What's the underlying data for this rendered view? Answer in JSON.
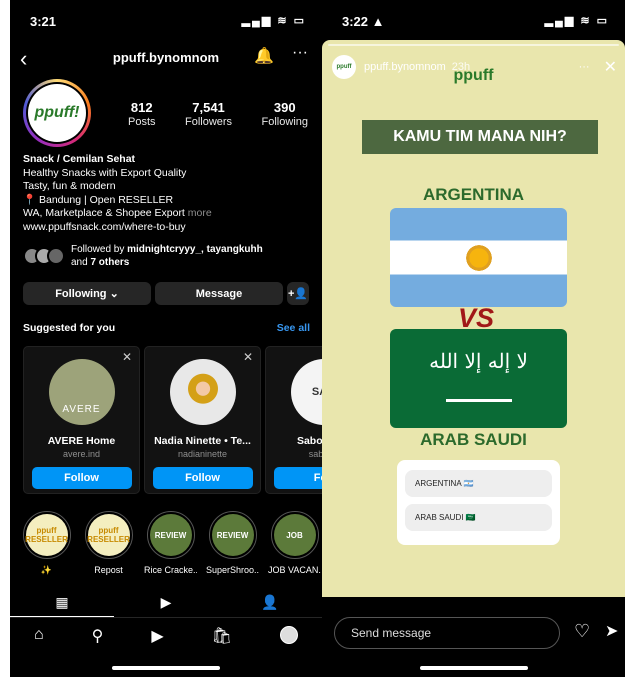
{
  "left": {
    "status": {
      "time": "3:21",
      "icons": "▂▄▆ ≋ ▭"
    },
    "header": {
      "username": "ppuff.bynomnom"
    },
    "avatar_text": "ppuff!",
    "stats": [
      {
        "num": "812",
        "label": "Posts"
      },
      {
        "num": "7,541",
        "label": "Followers"
      },
      {
        "num": "390",
        "label": "Following"
      }
    ],
    "bio": {
      "name": "Snack / Cemilan Sehat",
      "lines": [
        "Healthy Snacks with Export Quality",
        "Tasty, fun & modern",
        "📍 Bandung | Open RESELLER"
      ],
      "last_line": "WA, Marketplace & Shopee Export",
      "more": "more",
      "link": "www.ppuffsnack.com/where-to-buy"
    },
    "followed": {
      "prefix": "Followed by ",
      "names": "midnightcryyy_, tayangkuhh",
      "and": "and ",
      "others": "7 others"
    },
    "actions": {
      "following": "Following ⌄",
      "message": "Message",
      "add": "+👤"
    },
    "suggested": {
      "title": "Suggested for you",
      "see_all": "See all"
    },
    "cards": [
      {
        "name": "AVERE Home",
        "user": "avere.ind",
        "pic": "AVERE",
        "follow": "Follow"
      },
      {
        "name": "Nadia Ninette • Te...",
        "user": "nadianinette",
        "pic": "",
        "follow": "Follow"
      },
      {
        "name": "Saboën by",
        "user": "saboen",
        "pic": "SAB",
        "follow": "Foll"
      }
    ],
    "highlights": [
      {
        "label": "✨",
        "badge": "ppuff RESELLER"
      },
      {
        "label": "Repost",
        "badge": "ppuff RESELLER"
      },
      {
        "label": "Rice Cracke...",
        "badge": "REVIEW"
      },
      {
        "label": "SuperShroo...",
        "badge": "REVIEW"
      },
      {
        "label": "JOB VACAN...",
        "badge": "JOB"
      }
    ]
  },
  "right": {
    "status": {
      "time": "3:22 ▲",
      "icons": "▂▄▆ ≋ ▭"
    },
    "story": {
      "user": "ppuff.bynomnom",
      "age": "23h",
      "avatar": "ppuff",
      "brand": "ppuff",
      "question": "KAMU TIM MANA NIH?",
      "team1": "ARGENTINA",
      "vs": "VS",
      "team2": "ARAB SAUDI",
      "ksa_script": "لا إله إلا الله",
      "poll_options": [
        "ARGENTINA 🇦🇷",
        "ARAB SAUDI 🇸🇦"
      ]
    },
    "send_placeholder": "Send message"
  }
}
